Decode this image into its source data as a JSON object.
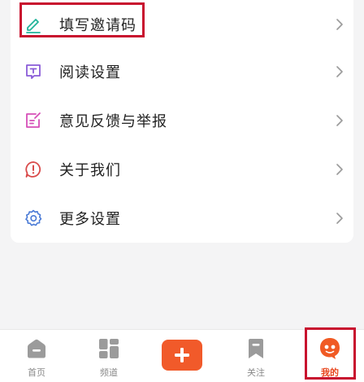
{
  "menu": {
    "items": [
      {
        "label": "填写邀请码",
        "icon": "pencil-icon",
        "color": "#22b39a"
      },
      {
        "label": "阅读设置",
        "icon": "reading-icon",
        "color": "#8a5cd8"
      },
      {
        "label": "意见反馈与举报",
        "icon": "feedback-icon",
        "color": "#d64fb8"
      },
      {
        "label": "关于我们",
        "icon": "info-icon",
        "color": "#d94a4a"
      },
      {
        "label": "更多设置",
        "icon": "gear-icon",
        "color": "#4a7ad6"
      }
    ]
  },
  "tabbar": {
    "home_label": "首页",
    "channel_label": "频道",
    "follow_label": "关注",
    "mine_label": "我的",
    "active_color": "#e8461e",
    "inactive_color": "#8a8a8a"
  }
}
